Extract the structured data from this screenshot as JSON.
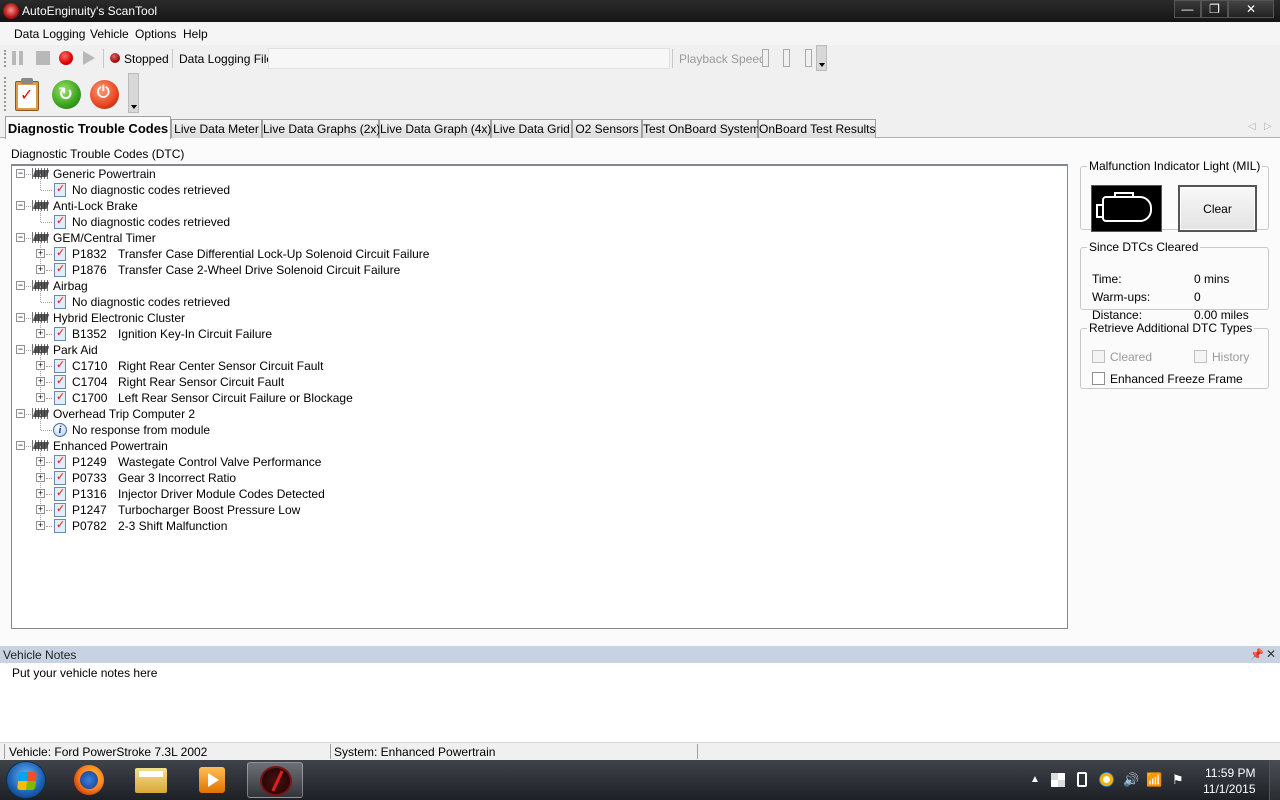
{
  "window": {
    "title": "AutoEnginuity's ScanTool",
    "min_glyph": "—",
    "max_glyph": "❐",
    "close_glyph": "✕"
  },
  "menu": [
    "Data Logging",
    "Vehicle",
    "Options",
    "Help"
  ],
  "logging": {
    "status": "Stopped",
    "file_label": "Data Logging File",
    "file_value": "",
    "playback_label": "Playback Speed"
  },
  "tabs": [
    "Diagnostic Trouble Codes",
    "Live Data Meter",
    "Live Data Graphs (2x)",
    "Live Data Graph (4x)",
    "Live Data Grid",
    "O2 Sensors",
    "Test OnBoard System",
    "OnBoard Test Results"
  ],
  "tab_scroll": {
    "left": "◁",
    "right": "▷"
  },
  "dtc": {
    "heading": "Diagnostic Trouble Codes (DTC)",
    "modules": [
      {
        "name": "Generic Powertrain",
        "items": [
          {
            "type": "none",
            "code": "",
            "desc": "No diagnostic codes retrieved"
          }
        ]
      },
      {
        "name": "Anti-Lock Brake",
        "items": [
          {
            "type": "none",
            "code": "",
            "desc": "No diagnostic codes retrieved"
          }
        ]
      },
      {
        "name": "GEM/Central Timer",
        "items": [
          {
            "type": "code",
            "code": "P1832",
            "desc": "Transfer Case Differential Lock-Up Solenoid Circuit Failure"
          },
          {
            "type": "code",
            "code": "P1876",
            "desc": "Transfer Case 2-Wheel Drive Solenoid Circuit Failure"
          }
        ]
      },
      {
        "name": "Airbag",
        "items": [
          {
            "type": "none",
            "code": "",
            "desc": "No diagnostic codes retrieved"
          }
        ]
      },
      {
        "name": "Hybrid Electronic Cluster",
        "items": [
          {
            "type": "code",
            "code": "B1352",
            "desc": "Ignition Key-In Circuit Failure"
          }
        ]
      },
      {
        "name": "Park Aid",
        "items": [
          {
            "type": "code",
            "code": "C1710",
            "desc": "Right Rear Center Sensor Circuit Fault"
          },
          {
            "type": "code",
            "code": "C1704",
            "desc": "Right Rear Sensor Circuit Fault"
          },
          {
            "type": "code",
            "code": "C1700",
            "desc": "Left Rear Sensor Circuit Failure or Blockage"
          }
        ]
      },
      {
        "name": "Overhead Trip Computer 2",
        "items": [
          {
            "type": "info",
            "code": "",
            "desc": "No response from module"
          }
        ]
      },
      {
        "name": "Enhanced Powertrain",
        "items": [
          {
            "type": "code",
            "code": "P1249",
            "desc": "Wastegate Control Valve Performance"
          },
          {
            "type": "code",
            "code": "P0733",
            "desc": "Gear 3 Incorrect Ratio"
          },
          {
            "type": "code",
            "code": "P1316",
            "desc": "Injector Driver Module Codes Detected"
          },
          {
            "type": "code",
            "code": "P1247",
            "desc": "Turbocharger Boost Pressure Low"
          },
          {
            "type": "code",
            "code": "P0782",
            "desc": "2-3 Shift Malfunction"
          }
        ]
      }
    ]
  },
  "mil": {
    "legend": "Malfunction Indicator Light (MIL)",
    "clear_label": "Clear"
  },
  "since_cleared": {
    "legend": "Since DTCs Cleared",
    "rows": [
      {
        "label": "Time:",
        "value": "0 mins"
      },
      {
        "label": "Warm-ups:",
        "value": "0"
      },
      {
        "label": "Distance:",
        "value": "0.00 miles"
      }
    ]
  },
  "retrieve": {
    "legend": "Retrieve Additional DTC Types",
    "cleared_label": "Cleared",
    "history_label": "History",
    "freeze_label": "Enhanced Freeze Frame",
    "cleared_checked": false,
    "history_checked": false,
    "freeze_checked": false
  },
  "notes": {
    "title": "Vehicle Notes",
    "placeholder": "Put your vehicle notes here",
    "pin_glyph": "📌",
    "close_glyph": "✕"
  },
  "status": {
    "vehicle": "Vehicle: Ford  PowerStroke 7.3L  2002",
    "system": "System: Enhanced Powertrain"
  },
  "taskbar": {
    "apps": [
      "firefox-icon",
      "file-explorer-icon",
      "media-player-icon",
      "scantool-icon"
    ],
    "tray": {
      "arrow": "▲",
      "flag": "⚑",
      "volume": "🔊",
      "signal": "📶",
      "action_center": "⚐"
    },
    "time": "11:59 PM",
    "date": "11/1/2015"
  }
}
